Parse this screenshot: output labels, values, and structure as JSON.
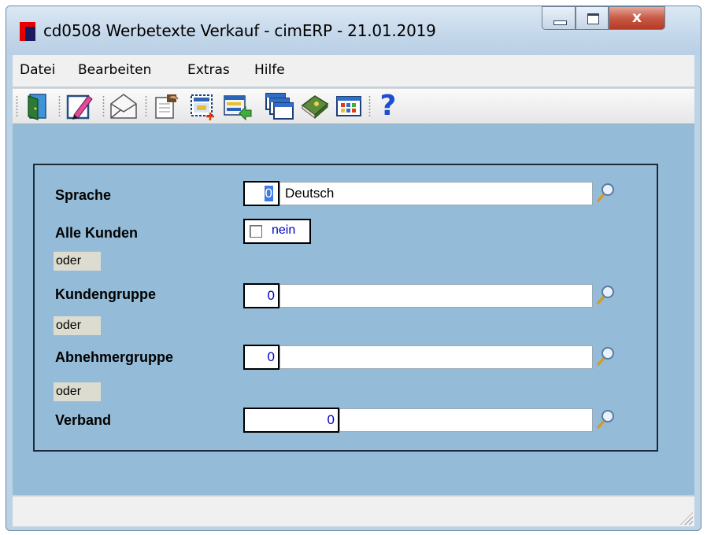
{
  "window": {
    "title": "cd0508 Werbetexte Verkauf - cimERP - 21.01.2019",
    "controls": {
      "close_glyph": "x"
    }
  },
  "menu": {
    "items": [
      {
        "label": "Datei"
      },
      {
        "label": "Bearbeiten"
      },
      {
        "label": "Extras"
      },
      {
        "label": "Hilfe"
      }
    ]
  },
  "toolbar": {
    "icons": [
      "exit-door-icon",
      "edit-pencil-icon",
      "envelope-icon",
      "notepad-hand-icon",
      "new-record-icon",
      "list-import-icon",
      "windows-icon",
      "book-icon",
      "grid-icon",
      "help-icon"
    ],
    "help_glyph": "?"
  },
  "form": {
    "sprache": {
      "label": "Sprache",
      "code": "0",
      "value": "Deutsch"
    },
    "alle_kunden": {
      "label": "Alle Kunden",
      "checked": false,
      "value": "nein"
    },
    "oder": "oder",
    "kundengruppe": {
      "label": "Kundengruppe",
      "code": "0",
      "value": ""
    },
    "abnehmergruppe": {
      "label": "Abnehmergruppe",
      "code": "0",
      "value": ""
    },
    "verband": {
      "label": "Verband",
      "code": "0",
      "value": ""
    }
  },
  "colors": {
    "content_bg": "#94bcd8",
    "value_blue": "#0000c8"
  }
}
